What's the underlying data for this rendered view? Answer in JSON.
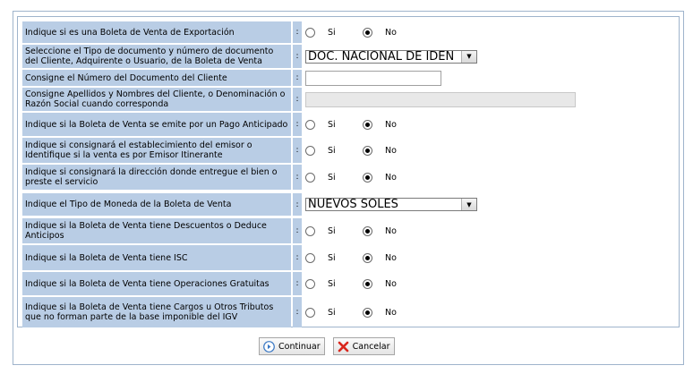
{
  "form": {
    "rows": [
      {
        "label": "Indique si es una Boleta de Venta de Exportación",
        "sep": ":",
        "type": "radio",
        "si": "Si",
        "no": "No",
        "selected": "No"
      },
      {
        "label": "Seleccione el Tipo de documento y número de documento del Cliente, Adquirente o Usuario, de la Boleta de Venta",
        "sep": ":",
        "type": "select",
        "value": "DOC. NACIONAL DE IDEN"
      },
      {
        "label": "Consigne el Número del Documento del Cliente",
        "sep": ":",
        "type": "text",
        "value": ""
      },
      {
        "label": "Consigne Apellidos y Nombres del Cliente, o Denominación o Razón Social cuando corresponda",
        "sep": ":",
        "type": "text-disabled",
        "value": ""
      },
      {
        "label": "Indique si la Boleta de Venta se emite por un Pago Anticipado",
        "sep": ":",
        "type": "radio",
        "si": "Si",
        "no": "No",
        "selected": "No"
      },
      {
        "label": "Indique si consignará el establecimiento del emisor o Identifique si la venta es por Emisor Itinerante",
        "sep": ":",
        "type": "radio",
        "si": "Si",
        "no": "No",
        "selected": "No"
      },
      {
        "label": "Indique si consignará la dirección donde entregue el bien o preste el servicio",
        "sep": ":",
        "type": "radio",
        "si": "Si",
        "no": "No",
        "selected": "No"
      },
      {
        "label": "Indique el Tipo de Moneda de la Boleta de Venta",
        "sep": ":",
        "type": "select",
        "value": "NUEVOS SOLES"
      },
      {
        "label": "Indique si la Boleta de Venta tiene Descuentos o Deduce Anticipos",
        "sep": ":",
        "type": "radio",
        "si": "Si",
        "no": "No",
        "selected": "No"
      },
      {
        "label": "Indique si la Boleta de Venta tiene ISC",
        "sep": ":",
        "type": "radio",
        "si": "Si",
        "no": "No",
        "selected": "No"
      },
      {
        "label": "Indique si la Boleta de Venta tiene Operaciones Gratuitas",
        "sep": ":",
        "type": "radio",
        "si": "Si",
        "no": "No",
        "selected": "No"
      },
      {
        "label": "Indique si la Boleta de Venta tiene Cargos u Otros Tributos que no forman parte de la base imponible del IGV",
        "sep": ":",
        "type": "radio",
        "si": "Si",
        "no": "No",
        "selected": "No"
      }
    ]
  },
  "buttons": {
    "continue_label": "Continuar",
    "cancel_label": "Cancelar",
    "continue_icon": "arrow-right-circle-icon",
    "cancel_icon": "red-x-icon"
  },
  "colors": {
    "label_bg": "#b9cde5",
    "border": "#9fb4cc",
    "cancel_icon": "#d9261c",
    "continue_icon": "#3a78c4"
  }
}
